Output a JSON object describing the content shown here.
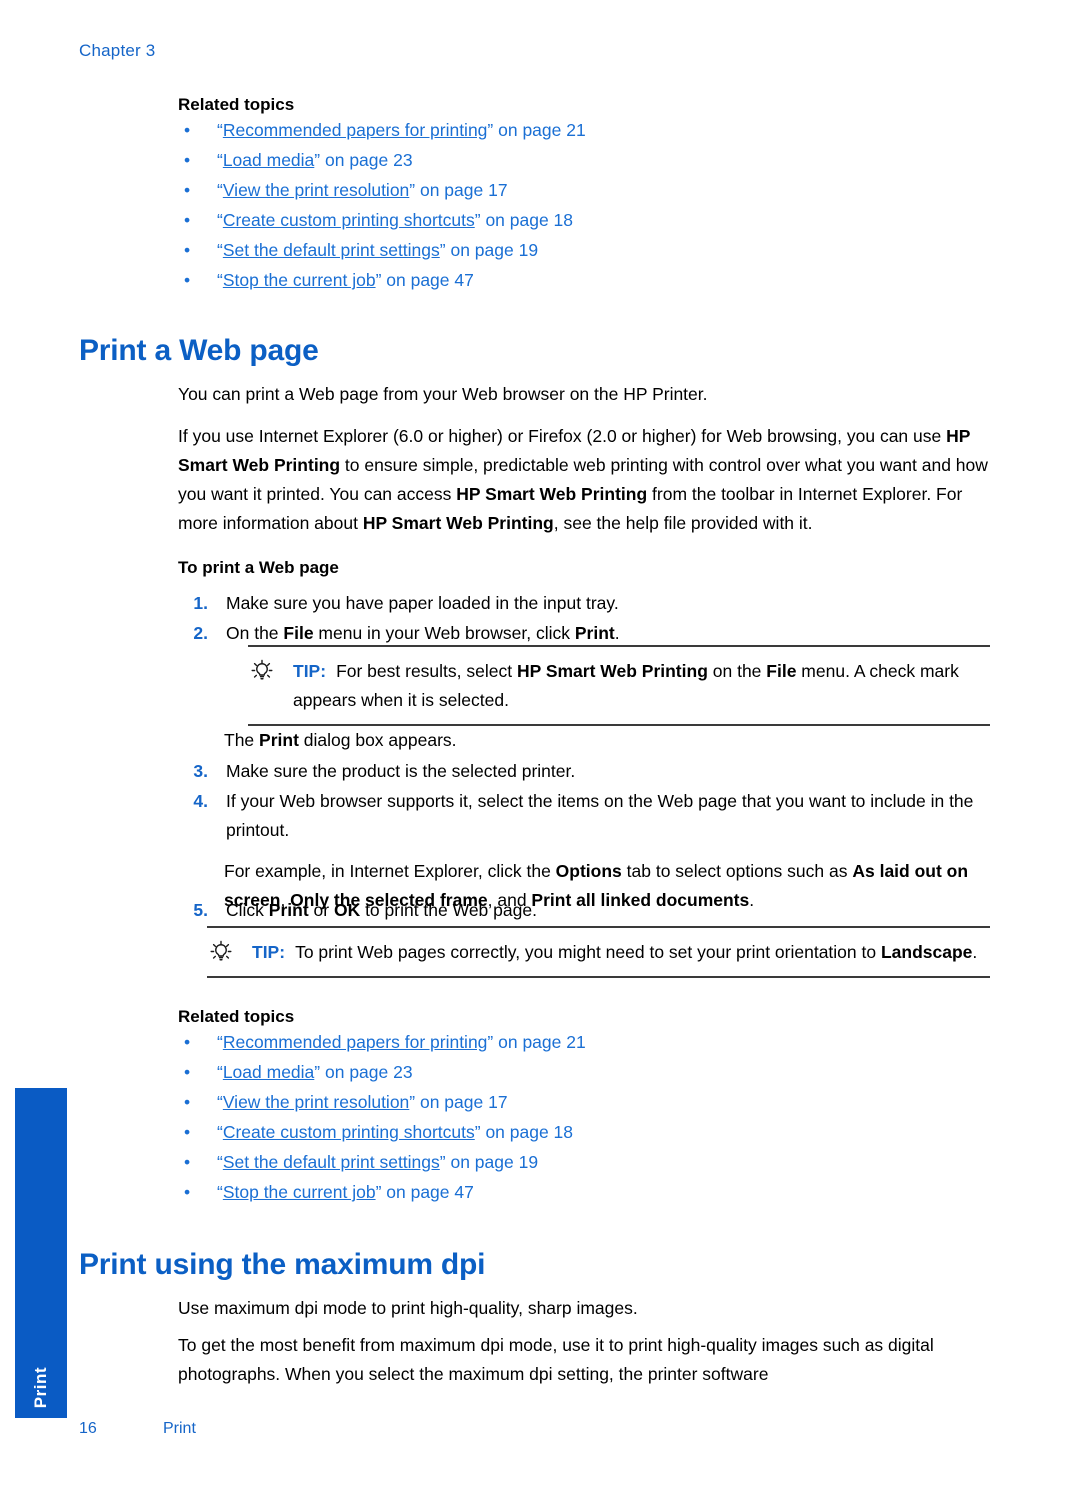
{
  "page": {
    "chapter_label": "Chapter 3",
    "footer_page_number": "16",
    "footer_section": "Print",
    "side_tab_label": "Print",
    "accent_heading_color": "#0B5FC4",
    "link_color": "#1A6FD4",
    "chapter_color": "#1565C8",
    "side_tab_color": "#0A5BC4"
  },
  "related_topics_top": {
    "heading": "Related topics",
    "items": [
      {
        "open_quote": "“",
        "link": "Recommended papers for printing",
        "close_quote": "”",
        "trail": " on page 21"
      },
      {
        "open_quote": "“",
        "link": "Load media",
        "close_quote": "”",
        "trail": " on page 23"
      },
      {
        "open_quote": "“",
        "link": "View the print resolution",
        "close_quote": "”",
        "trail": " on page 17"
      },
      {
        "open_quote": "“",
        "link": "Create custom printing shortcuts",
        "close_quote": "”",
        "trail": " on page 18"
      },
      {
        "open_quote": "“",
        "link": "Set the default print settings",
        "close_quote": "”",
        "trail": " on page 19"
      },
      {
        "open_quote": "“",
        "link": "Stop the current job",
        "close_quote": "”",
        "trail": " on page 47"
      }
    ]
  },
  "section_web_page": {
    "heading": "Print a Web page",
    "para1": "You can print a Web page from your Web browser on the HP Printer.",
    "para2_parts": [
      {
        "t": "If you use Internet Explorer (6.0 or higher) or Firefox (2.0 or higher) for Web browsing, you can use ",
        "b": false
      },
      {
        "t": "HP Smart Web Printing",
        "b": true
      },
      {
        "t": " to ensure simple, predictable web printing with control over what you want and how you want it printed. You can access ",
        "b": false
      },
      {
        "t": "HP Smart Web Printing",
        "b": true
      },
      {
        "t": " from the toolbar in Internet Explorer. For more information about ",
        "b": false
      },
      {
        "t": "HP Smart Web Printing",
        "b": true
      },
      {
        "t": ", see the help file provided with it.",
        "b": false
      }
    ],
    "procedure_heading": "To print a Web page",
    "steps": [
      {
        "num": "1.",
        "parts": [
          {
            "t": "Make sure you have paper loaded in the input tray.",
            "b": false
          }
        ]
      },
      {
        "num": "2.",
        "parts": [
          {
            "t": "On the ",
            "b": false
          },
          {
            "t": "File",
            "b": true
          },
          {
            "t": " menu in your Web browser, click ",
            "b": false
          },
          {
            "t": "Print",
            "b": true
          },
          {
            "t": ".",
            "b": false
          }
        ]
      },
      {
        "num": "3.",
        "parts": [
          {
            "t": "Make sure the product is the selected printer.",
            "b": false
          }
        ]
      },
      {
        "num": "4.",
        "parts": [
          {
            "t": "If your Web browser supports it, select the items on the Web page that you want to include in the printout.",
            "b": false
          }
        ]
      },
      {
        "num": "5.",
        "parts": [
          {
            "t": "Click ",
            "b": false
          },
          {
            "t": "Print",
            "b": true
          },
          {
            "t": " or ",
            "b": false
          },
          {
            "t": "OK",
            "b": true
          },
          {
            "t": " to print the Web page.",
            "b": false
          }
        ]
      }
    ],
    "tip1": {
      "icon": "lightbulb-icon",
      "word": "TIP:",
      "parts": [
        {
          "t": "For best results, select ",
          "b": false
        },
        {
          "t": "HP Smart Web Printing",
          "b": true
        },
        {
          "t": " on the ",
          "b": false
        },
        {
          "t": "File",
          "b": true
        },
        {
          "t": " menu. A check mark appears when it is selected.",
          "b": false
        }
      ]
    },
    "after_tip1_parts": [
      {
        "t": "The ",
        "b": false
      },
      {
        "t": "Print",
        "b": true
      },
      {
        "t": " dialog box appears.",
        "b": false
      }
    ],
    "step4_extra_parts": [
      {
        "t": "For example, in Internet Explorer, click the ",
        "b": false
      },
      {
        "t": "Options",
        "b": true
      },
      {
        "t": " tab to select options such as ",
        "b": false
      },
      {
        "t": "As laid out on screen",
        "b": true
      },
      {
        "t": ", ",
        "b": false
      },
      {
        "t": "Only the selected frame",
        "b": true
      },
      {
        "t": ", and ",
        "b": false
      },
      {
        "t": "Print all linked documents",
        "b": true
      },
      {
        "t": ".",
        "b": false
      }
    ],
    "tip2": {
      "icon": "lightbulb-icon",
      "word": "TIP:",
      "parts": [
        {
          "t": "To print Web pages correctly, you might need to set your print orientation to ",
          "b": false
        },
        {
          "t": "Landscape",
          "b": true
        },
        {
          "t": ".",
          "b": false
        }
      ]
    }
  },
  "related_topics_bottom": {
    "heading": "Related topics",
    "items": [
      {
        "open_quote": "“",
        "link": "Recommended papers for printing",
        "close_quote": "”",
        "trail": " on page 21"
      },
      {
        "open_quote": "“",
        "link": "Load media",
        "close_quote": "”",
        "trail": " on page 23"
      },
      {
        "open_quote": "“",
        "link": "View the print resolution",
        "close_quote": "”",
        "trail": " on page 17"
      },
      {
        "open_quote": "“",
        "link": "Create custom printing shortcuts",
        "close_quote": "”",
        "trail": " on page 18"
      },
      {
        "open_quote": "“",
        "link": "Set the default print settings",
        "close_quote": "”",
        "trail": " on page 19"
      },
      {
        "open_quote": "“",
        "link": "Stop the current job",
        "close_quote": "”",
        "trail": " on page 47"
      }
    ]
  },
  "section_max_dpi": {
    "heading": "Print using the maximum dpi",
    "para1": "Use maximum dpi mode to print high-quality, sharp images.",
    "para2": "To get the most benefit from maximum dpi mode, use it to print high-quality images such as digital photographs. When you select the maximum dpi setting, the printer software"
  }
}
